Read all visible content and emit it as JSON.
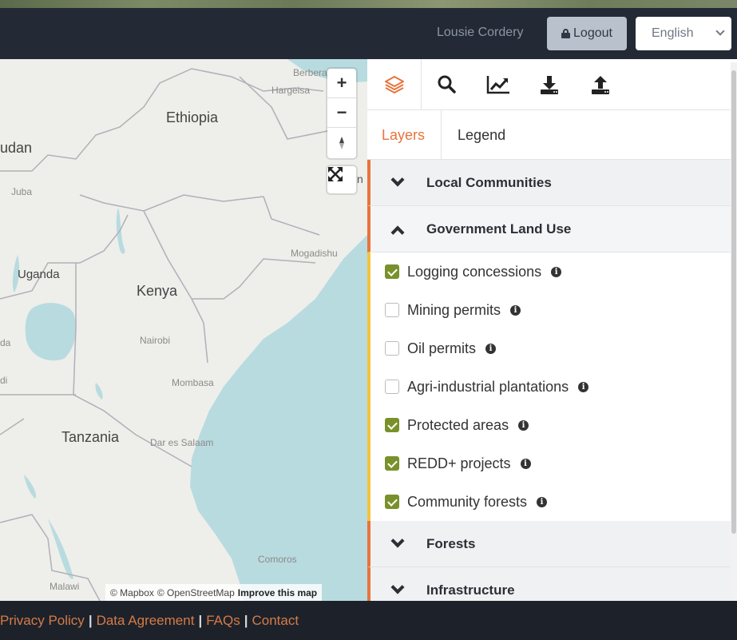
{
  "header": {
    "user_name": "Lousie Cordery",
    "logout_label": "Logout",
    "language": "English"
  },
  "map": {
    "country_labels": [
      "Ethiopia",
      "udan",
      "Uganda",
      "Kenya",
      "Tanzania"
    ],
    "city_labels": [
      "Berbera",
      "Hargeisa",
      "Juba",
      "Mogadishu",
      "Nairobi",
      "Mombasa",
      "Dar es Salaam",
      "Comoros",
      "Malawi",
      "da",
      "di",
      "n"
    ],
    "zoom_in": "+",
    "zoom_out": "−",
    "attribution": {
      "mapbox": "© Mapbox",
      "osm": "© OpenStreetMap",
      "improve": "Improve this map"
    }
  },
  "panel": {
    "tabs": {
      "layers": "Layers",
      "legend": "Legend"
    },
    "toolbar_icons": [
      "layers-icon",
      "search-icon",
      "chart-icon",
      "download-icon",
      "upload-icon"
    ],
    "sections": [
      {
        "title": "Local Communities",
        "expanded": false
      },
      {
        "title": "Government Land Use",
        "expanded": true
      },
      {
        "title": "Forests",
        "expanded": false
      },
      {
        "title": "Infrastructure",
        "expanded": false
      }
    ],
    "layers": [
      {
        "label": "Logging concessions",
        "checked": true
      },
      {
        "label": "Mining permits",
        "checked": false
      },
      {
        "label": "Oil permits",
        "checked": false
      },
      {
        "label": "Agri-industrial plantations",
        "checked": false
      },
      {
        "label": "Protected areas",
        "checked": true
      },
      {
        "label": "REDD+ projects",
        "checked": true
      },
      {
        "label": "Community forests",
        "checked": true
      }
    ]
  },
  "footer": {
    "links": [
      "Privacy Policy",
      "Data Agreement",
      "FAQs",
      "Contact"
    ],
    "separator": "|"
  },
  "colors": {
    "accent_orange": "#e8743b",
    "checkbox_green": "#79912b",
    "layer_border_yellow": "#f3c53b",
    "footer_link": "#d67a48"
  }
}
